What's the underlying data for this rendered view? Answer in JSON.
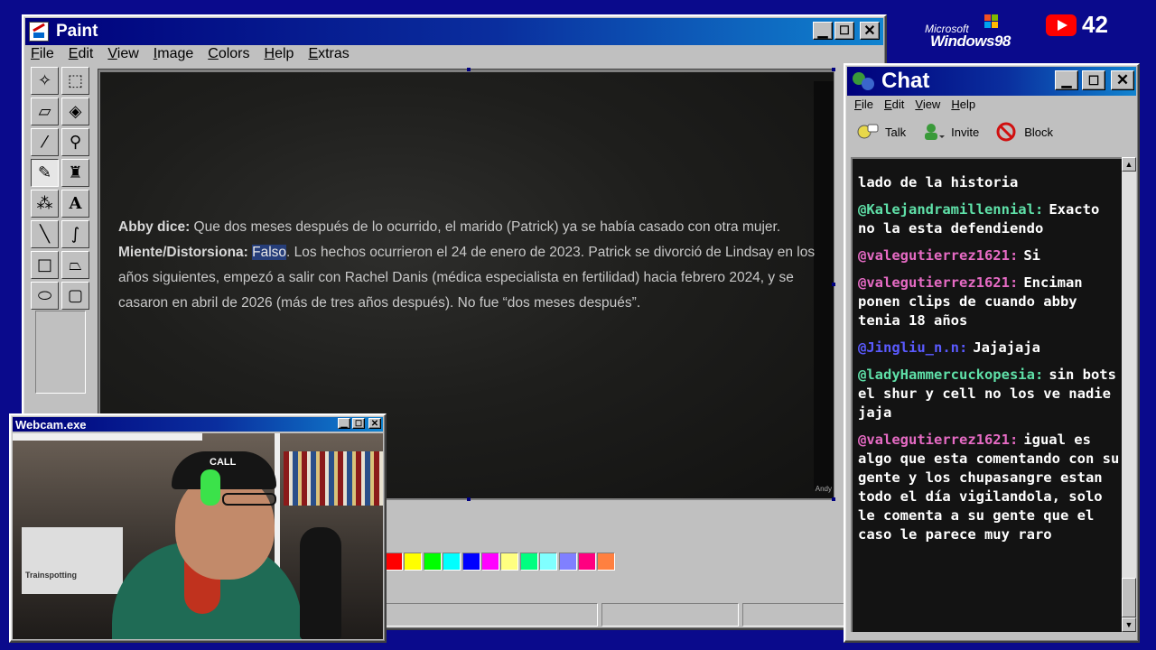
{
  "paint": {
    "title": "Paint",
    "menu": [
      "File",
      "Edit",
      "View",
      "Image",
      "Colors",
      "Help",
      "Extras"
    ],
    "tools": [
      "free-select-icon",
      "rect-select-icon",
      "eraser-icon",
      "fill-icon",
      "color-picker-icon",
      "magnifier-icon",
      "pencil-icon",
      "brush-icon",
      "airbrush-icon",
      "text-icon",
      "line-icon",
      "curve-icon",
      "rectangle-icon",
      "polygon-icon",
      "ellipse-icon",
      "rounded-rect-icon"
    ],
    "palette": [
      "#ff0000",
      "#ffff00",
      "#00ff00",
      "#00ffff",
      "#0000ff",
      "#ff00ff",
      "#ffff80",
      "#00ff80",
      "#80ffff",
      "#8080ff",
      "#ff0080",
      "#ff8040"
    ],
    "article": {
      "p1_label": "Abby dice:",
      "p1_text": " Que dos meses después de lo ocurrido, el marido (Patrick) ya se había casado con otra mujer.",
      "p2_label": "Miente/Distorsiona:",
      "p2_highlight": "Falso",
      "p2_text": ". Los hechos ocurrieron el 24 de enero de 2023. Patrick se divorció de Lindsay en los años siguientes, empezó a salir con Rachel Danis (médica especialista en fertilidad) hacia febrero 2024, y se casaron en abril de 2026 (más de tres años después). No fue “dos meses después”."
    },
    "canvas_caption": "Andy"
  },
  "branding": {
    "microsoft": "Microsoft",
    "windows": "Windows98",
    "yt_count": "42"
  },
  "chat": {
    "title": "Chat",
    "menu": [
      "File",
      "Edit",
      "View",
      "Help"
    ],
    "toolbar": {
      "talk": "Talk",
      "invite": "Invite",
      "block": "Block"
    },
    "messages": [
      {
        "user": "",
        "color": "#ffffff",
        "text": "lado de la historia"
      },
      {
        "user": "@Kalejandramillennial:",
        "color": "#5fe0a8",
        "text": "Exacto no la esta defendiendo"
      },
      {
        "user": "@valegutierrez1621:",
        "color": "#e66bc4",
        "text": "Si"
      },
      {
        "user": "@valegutierrez1621:",
        "color": "#e66bc4",
        "text": "Enciman ponen clips de cuando abby tenia 18 años"
      },
      {
        "user": "@Jingliu_n.n:",
        "color": "#5a5aff",
        "text": "Jajajaja"
      },
      {
        "user": "@ladyHammercuckopesia:",
        "color": "#5fe0a8",
        "text": "sin bots el shur y cell no los ve nadie jaja"
      },
      {
        "user": "@valegutierrez1621:",
        "color": "#e66bc4",
        "text": "igual es algo que esta comentando con su gente y los chupasangre estan todo el día vigilandola, solo le comenta a su gente que el caso le parece muy raro"
      }
    ]
  },
  "webcam": {
    "title": "Webcam.exe",
    "cap_text": "CALL",
    "poster_text": "Trainspotting"
  }
}
